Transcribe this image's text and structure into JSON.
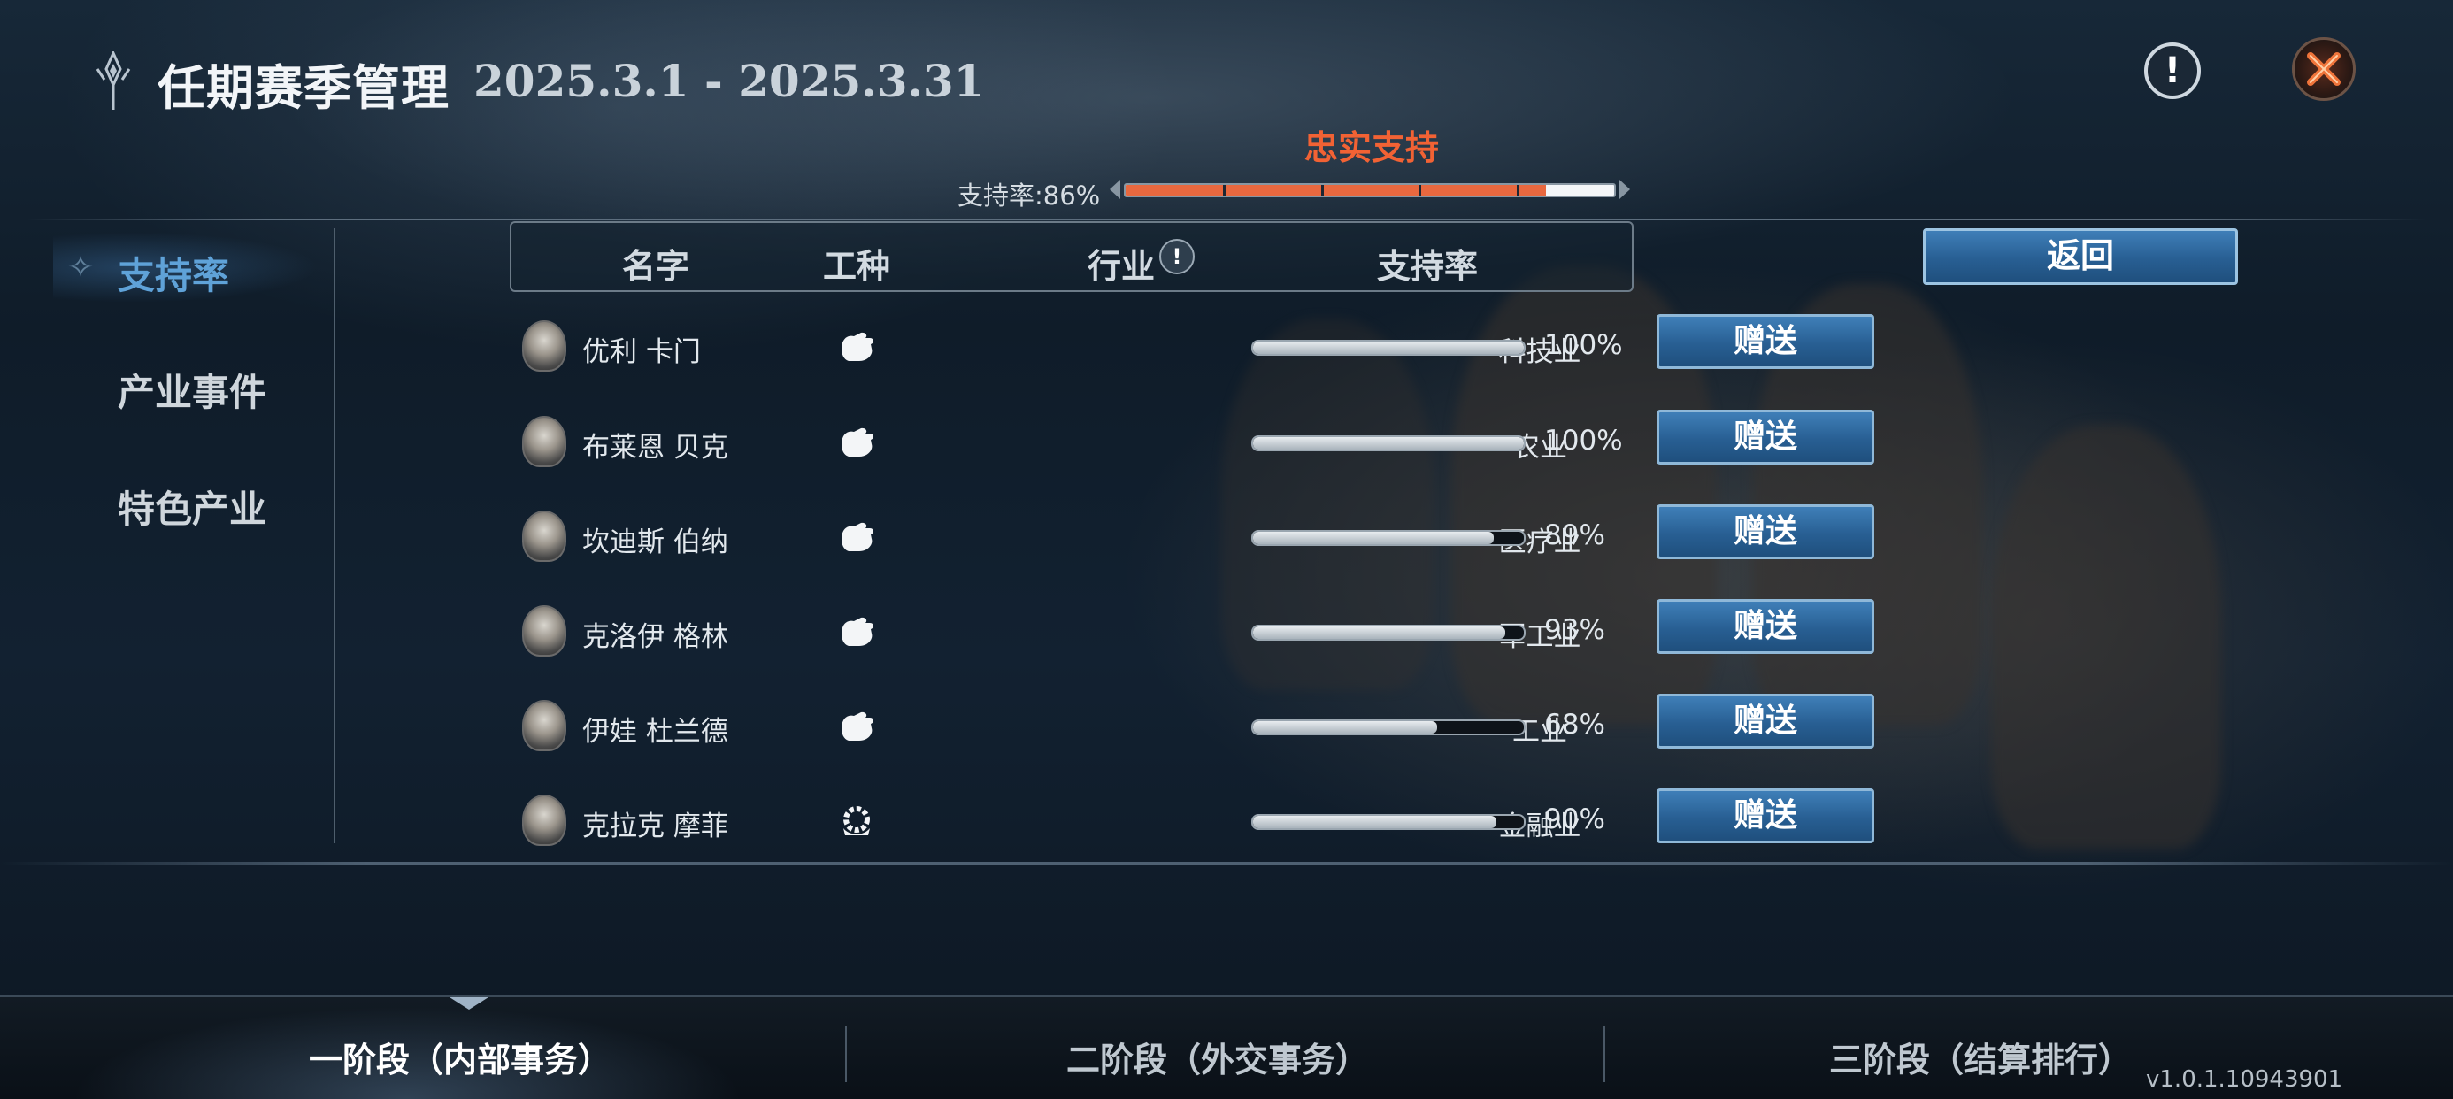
{
  "header": {
    "title": "任期赛季管理",
    "dates": "2025.3.1 - 2025.3.31",
    "info_icon_glyph": "!"
  },
  "loyalty": {
    "title": "忠实支持",
    "approval_label": "支持率:86%",
    "approval_value": 86
  },
  "nav": {
    "items": [
      {
        "label": "支持率",
        "active": true
      },
      {
        "label": "产业事件",
        "active": false
      },
      {
        "label": "特色产业",
        "active": false
      }
    ]
  },
  "table": {
    "headers": {
      "name": "名字",
      "job": "工种",
      "industry": "行业",
      "approval": "支持率"
    },
    "industry_info_glyph": "!",
    "rows": [
      {
        "name": "优利 卡门",
        "job_icon": "glove-icon",
        "industry": "科技业",
        "approval": 100,
        "approval_text": "100%"
      },
      {
        "name": "布莱恩 贝克",
        "job_icon": "glove-icon",
        "industry": "农业",
        "approval": 100,
        "approval_text": "100%"
      },
      {
        "name": "坎迪斯 伯纳",
        "job_icon": "glove-icon",
        "industry": "医疗业",
        "approval": 89,
        "approval_text": "89%"
      },
      {
        "name": "克洛伊 格林",
        "job_icon": "glove-icon",
        "industry": "军工业",
        "approval": 93,
        "approval_text": "93%"
      },
      {
        "name": "伊娃 杜兰德",
        "job_icon": "glove-icon",
        "industry": "工业",
        "approval": 68,
        "approval_text": "68%"
      },
      {
        "name": "克拉克 摩菲",
        "job_icon": "gear-hand-icon",
        "industry": "金融业",
        "approval": 90,
        "approval_text": "90%"
      }
    ],
    "gift_label": "赠送"
  },
  "back_label": "返回",
  "tabs": [
    {
      "label": "一阶段（内部事务）",
      "active": true
    },
    {
      "label": "二阶段（外交事务）",
      "active": false
    },
    {
      "label": "三阶段（结算排行）",
      "active": false
    }
  ],
  "version": "v1.0.1.10943901",
  "colors": {
    "accent_orange": "#f26234",
    "button_blue": "#285f93",
    "nav_active": "#5fa2d8"
  }
}
